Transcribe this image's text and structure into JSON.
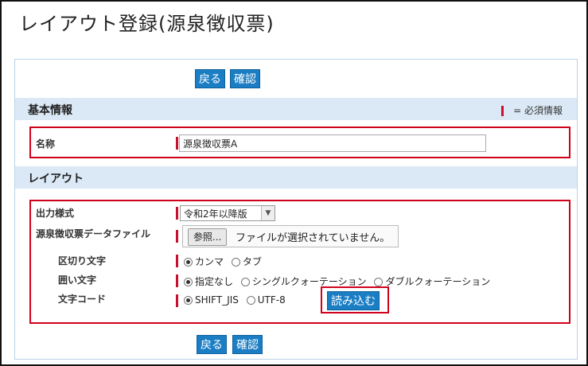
{
  "page": {
    "title": "レイアウト登録(源泉徴収票)"
  },
  "toolbar": {
    "back_label": "戻る",
    "confirm_label": "確認"
  },
  "basic_section": {
    "title": "基本情報",
    "required_legend": "= 必須情報",
    "name_label": "名称",
    "name_value": "源泉徴収票A"
  },
  "layout_section": {
    "title": "レイアウト",
    "output_format_label": "出力様式",
    "output_format_value": "令和2年以降版",
    "data_file_label": "源泉徴収票データファイル",
    "file_button_label": "参照...",
    "file_status": "ファイルが選択されていません。",
    "delimiter_label": "区切り文字",
    "delimiter_options": [
      "カンマ",
      "タブ"
    ],
    "delimiter_selected": 0,
    "quote_label": "囲い文字",
    "quote_options": [
      "指定なし",
      "シングルクォーテーション",
      "ダブルクォーテーション"
    ],
    "quote_selected": 0,
    "encoding_label": "文字コード",
    "encoding_options": [
      "SHIFT_JIS",
      "UTF-8"
    ],
    "encoding_selected": 0,
    "load_button_label": "読み込む"
  },
  "colors": {
    "button_bg": "#1b7ec4",
    "section_bg": "#dbe9f6",
    "required_mark": "#c8102e",
    "highlight": "#d0021b"
  }
}
